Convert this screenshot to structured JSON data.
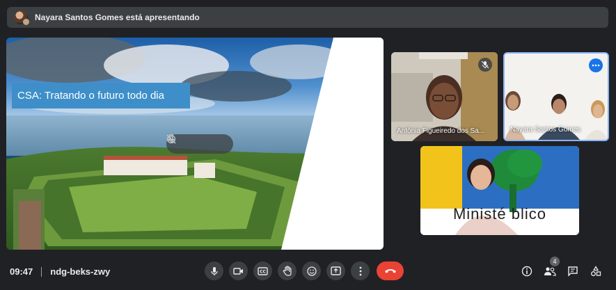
{
  "banner": {
    "presenting_text": "Nayara Santos Gomes está apresentando"
  },
  "presentation": {
    "slide_title": "CSA: Tratando o futuro todo dia"
  },
  "participants": [
    {
      "name": "Antônia Figueiredo dos Sa...",
      "muted": true
    },
    {
      "name": "Nayara Santos Gomes",
      "speaking": true
    },
    {
      "name": "",
      "background_text": "Ministé blico"
    }
  ],
  "bottom_bar": {
    "time": "09:47",
    "meeting_code": "ndg-beks-zwy",
    "participant_count": "4"
  },
  "colors": {
    "background": "#202124",
    "button": "#3c4043",
    "end_call": "#ea4335",
    "accent": "#8ab4f8",
    "slide_banner": "#3e8fc9"
  },
  "icons": {
    "controls": [
      "mic-icon",
      "camera-icon",
      "captions-icon",
      "raise-hand-icon",
      "emoji-icon",
      "present-icon",
      "more-options-icon",
      "end-call-icon"
    ],
    "right": [
      "info-icon",
      "people-icon",
      "chat-icon",
      "activities-icon"
    ]
  }
}
